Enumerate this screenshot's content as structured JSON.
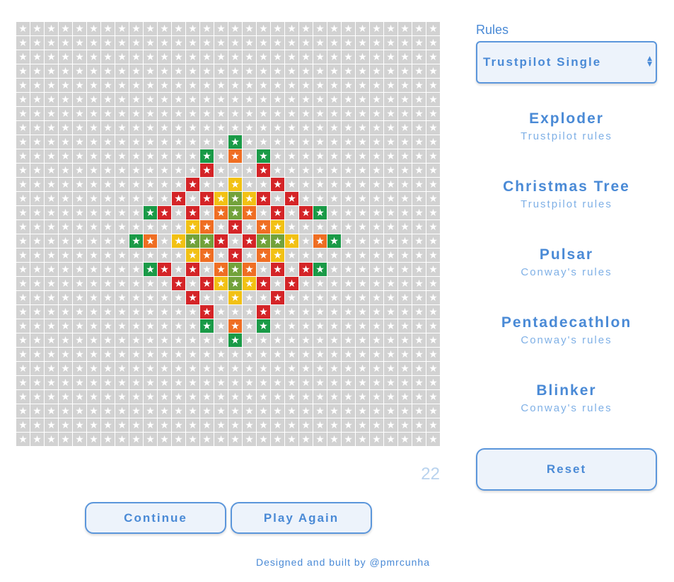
{
  "board": {
    "rows": 30,
    "cols": 30,
    "empty_color": "#d2d2d2",
    "star_glyph": "★",
    "palette": {
      "r": "#d42427",
      "o": "#ef6e23",
      "y": "#f2c114",
      "l": "#72a23a",
      "g": "#1a9a47"
    },
    "cells": {
      "8": {
        "15": "g"
      },
      "9": {
        "13": "g",
        "15": "o",
        "17": "g"
      },
      "10": {
        "13": "r",
        "17": "r"
      },
      "11": {
        "12": "r",
        "15": "y",
        "18": "r"
      },
      "12": {
        "11": "r",
        "13": "r",
        "14": "y",
        "15": "l",
        "16": "y",
        "17": "r",
        "19": "r"
      },
      "13": {
        "9": "g",
        "10": "r",
        "12": "r",
        "14": "o",
        "15": "l",
        "16": "o",
        "18": "r",
        "20": "r",
        "21": "g"
      },
      "14": {
        "12": "y",
        "13": "o",
        "15": "r",
        "17": "o",
        "18": "y"
      },
      "15": {
        "8": "g",
        "9": "o",
        "11": "y",
        "12": "l",
        "13": "l",
        "14": "r",
        "16": "r",
        "17": "l",
        "18": "l",
        "19": "y",
        "21": "o",
        "22": "g"
      },
      "16": {
        "12": "y",
        "13": "o",
        "15": "r",
        "17": "o",
        "18": "y"
      },
      "17": {
        "9": "g",
        "10": "r",
        "12": "r",
        "14": "o",
        "15": "l",
        "16": "o",
        "18": "r",
        "20": "r",
        "21": "g"
      },
      "18": {
        "11": "r",
        "13": "r",
        "14": "y",
        "15": "l",
        "16": "y",
        "17": "r",
        "19": "r"
      },
      "19": {
        "12": "r",
        "15": "y",
        "18": "r"
      },
      "20": {
        "13": "r",
        "17": "r"
      },
      "21": {
        "13": "g",
        "15": "o",
        "17": "g"
      },
      "22": {
        "15": "g"
      }
    }
  },
  "generation": "22",
  "buttons": {
    "continue": "Continue",
    "play_again": "Play Again",
    "reset": "Reset"
  },
  "credit": "Designed and built by @pmrcunha",
  "sidebar": {
    "rules_label": "Rules",
    "rules_selected": "Trustpilot Single",
    "patterns": [
      {
        "name": "Exploder",
        "rules": "Trustpilot rules"
      },
      {
        "name": "Christmas Tree",
        "rules": "Trustpilot rules"
      },
      {
        "name": "Pulsar",
        "rules": "Conway's rules"
      },
      {
        "name": "Pentadecathlon",
        "rules": "Conway's rules"
      },
      {
        "name": "Blinker",
        "rules": "Conway's rules"
      }
    ]
  }
}
